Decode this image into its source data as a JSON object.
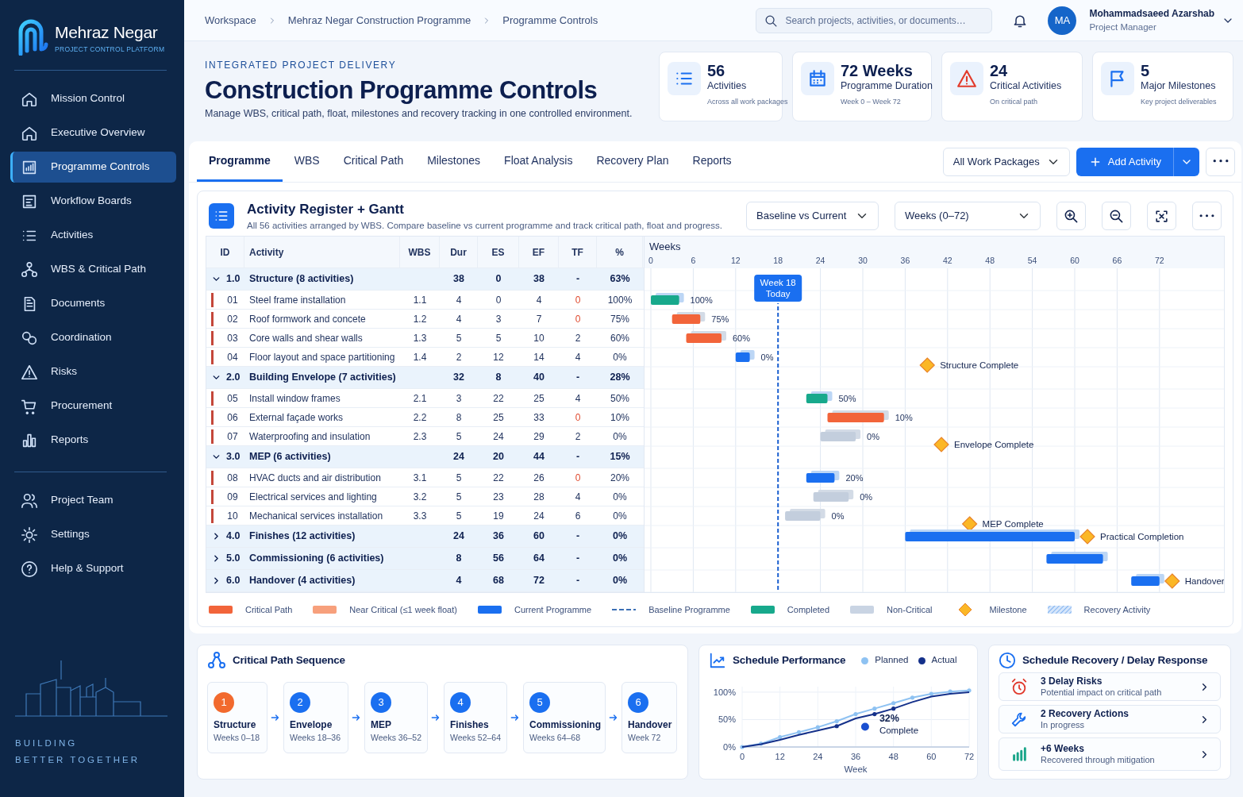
{
  "brand": {
    "name": "Mehraz Negar",
    "tagline": "PROJECT CONTROL PLATFORM"
  },
  "sidebar": {
    "items": [
      {
        "label": "Mission Control",
        "selected": false
      },
      {
        "label": "Executive Overview",
        "selected": false
      },
      {
        "label": "Programme Controls",
        "selected": true
      },
      {
        "label": "Workflow Boards",
        "selected": false
      },
      {
        "label": "Activities",
        "selected": false
      },
      {
        "label": "WBS & Critical Path",
        "selected": false
      },
      {
        "label": "Documents",
        "selected": false
      },
      {
        "label": "Coordination",
        "selected": false
      },
      {
        "label": "Risks",
        "selected": false
      },
      {
        "label": "Procurement",
        "selected": false
      },
      {
        "label": "Reports",
        "selected": false
      }
    ],
    "secondary": [
      {
        "label": "Project Team",
        "selected": false
      },
      {
        "label": "Settings",
        "selected": false
      },
      {
        "label": "Help & Support",
        "selected": false
      }
    ],
    "footer": [
      "BUILDING",
      "BETTER TOGETHER"
    ]
  },
  "breadcrumbs": [
    "Workspace",
    "Mehraz Negar Construction Programme",
    "Programme Controls"
  ],
  "search": {
    "placeholder": "Search projects, activities, or documents…"
  },
  "user": {
    "initials": "MA",
    "name": "Mohammadsaeed Azarshab",
    "role": "Project Manager"
  },
  "header": {
    "eyebrow": "INTEGRATED PROJECT DELIVERY",
    "title": "Construction Programme Controls",
    "subtitle": "Manage WBS, critical path, float, milestones and recovery tracking in one controlled environment."
  },
  "kpis": [
    {
      "value": "56",
      "label": "Activities",
      "note": "Across all work packages",
      "kind": "list"
    },
    {
      "value": "72 Weeks",
      "label": "Programme Duration",
      "note": "Week 0 – Week 72",
      "kind": "calendar"
    },
    {
      "value": "24",
      "label": "Critical Activities",
      "note": "On critical path",
      "kind": "alert"
    },
    {
      "value": "5",
      "label": "Major Milestones",
      "note": "Key project deliverables",
      "kind": "flag"
    }
  ],
  "tabs": [
    {
      "label": "Programme",
      "selected": true
    },
    {
      "label": "WBS",
      "selected": false
    },
    {
      "label": "Critical Path",
      "selected": false
    },
    {
      "label": "Milestones",
      "selected": false
    },
    {
      "label": "Float Analysis",
      "selected": false
    },
    {
      "label": "Recovery Plan",
      "selected": false
    },
    {
      "label": "Reports",
      "selected": false
    }
  ],
  "work_package_filter": "All Work Packages",
  "add_button": "Add Activity",
  "register": {
    "title": "Activity Register + Gantt",
    "description": "All 56 activities arranged by WBS. Compare baseline vs current programme and track critical path, float and progress.",
    "view_select": "Baseline vs Current",
    "range_select": "Weeks (0–72)",
    "columns": [
      "ID",
      "Activity",
      "WBS",
      "Dur",
      "ES",
      "EF",
      "TF",
      "%"
    ],
    "groups": [
      {
        "id": "1.0",
        "name": "Structure (8 activities)",
        "dur": "38",
        "es": "0",
        "ef": "38",
        "tf": "-",
        "pct": "63%",
        "expanded": true,
        "milestone": "Structure Complete",
        "children": [
          {
            "id": "01",
            "name": "Steel frame installation",
            "wbs": "1.1",
            "dur": "4",
            "es": "0",
            "ef": "4",
            "tf": "0",
            "pct": "100%",
            "critical": true,
            "kind": "completed",
            "bar_label": "100%"
          },
          {
            "id": "02",
            "name": "Roof formwork and concete",
            "wbs": "1.2",
            "dur": "4",
            "es": "3",
            "ef": "7",
            "tf": "0",
            "pct": "75%",
            "critical": true,
            "kind": "critical",
            "bar_label": "75%"
          },
          {
            "id": "03",
            "name": "Core walls and shear walls",
            "wbs": "1.3",
            "dur": "5",
            "es": "5",
            "ef": "10",
            "tf": "2",
            "pct": "60%",
            "critical": false,
            "kind": "critical",
            "bar_label": "60%"
          },
          {
            "id": "04",
            "name": "Floor layout and space partitioning",
            "wbs": "1.4",
            "dur": "2",
            "es": "12",
            "ef": "14",
            "tf": "4",
            "pct": "0%",
            "critical": false,
            "kind": "current",
            "bar_label": "0%"
          }
        ]
      },
      {
        "id": "2.0",
        "name": "Building Envelope (7 activities)",
        "dur": "32",
        "es": "8",
        "ef": "40",
        "tf": "-",
        "pct": "28%",
        "expanded": true,
        "milestone": "Envelope Complete",
        "children": [
          {
            "id": "05",
            "name": "Install window frames",
            "wbs": "2.1",
            "dur": "3",
            "es": "22",
            "ef": "25",
            "tf": "4",
            "pct": "50%",
            "critical": false,
            "kind": "completed",
            "bar_label": "50%"
          },
          {
            "id": "06",
            "name": "External façade works",
            "wbs": "2.2",
            "dur": "8",
            "es": "25",
            "ef": "33",
            "tf": "0",
            "pct": "10%",
            "critical": true,
            "kind": "critical",
            "bar_label": "10%"
          },
          {
            "id": "07",
            "name": "Waterproofing and insulation",
            "wbs": "2.3",
            "dur": "5",
            "es": "24",
            "ef": "29",
            "tf": "2",
            "pct": "0%",
            "critical": false,
            "kind": "non_critical",
            "bar_label": "0%"
          }
        ]
      },
      {
        "id": "3.0",
        "name": "MEP (6 activities)",
        "dur": "24",
        "es": "20",
        "ef": "44",
        "tf": "-",
        "pct": "15%",
        "expanded": true,
        "milestone": "MEP Complete",
        "children": [
          {
            "id": "08",
            "name": "HVAC ducts and air distribution",
            "wbs": "3.1",
            "dur": "5",
            "es": "22",
            "ef": "26",
            "tf": "0",
            "pct": "20%",
            "critical": true,
            "kind": "current",
            "bar_label": "20%"
          },
          {
            "id": "09",
            "name": "Electrical services and lighting",
            "wbs": "3.2",
            "dur": "5",
            "es": "23",
            "ef": "28",
            "tf": "4",
            "pct": "0%",
            "critical": false,
            "kind": "non_critical",
            "bar_label": "0%"
          },
          {
            "id": "10",
            "name": "Mechanical services installation",
            "wbs": "3.3",
            "dur": "5",
            "es": "19",
            "ef": "24",
            "tf": "6",
            "pct": "0%",
            "critical": false,
            "kind": "non_critical",
            "bar_label": "0%"
          }
        ]
      },
      {
        "id": "4.0",
        "name": "Finishes (12 activities)",
        "dur": "24",
        "es": "36",
        "ef": "60",
        "tf": "-",
        "pct": "0%",
        "expanded": false,
        "milestone": "Practical Completion",
        "kind": "current"
      },
      {
        "id": "5.0",
        "name": "Commissioning (6 activities)",
        "dur": "8",
        "es": "56",
        "ef": "64",
        "tf": "-",
        "pct": "0%",
        "expanded": false,
        "kind": "current"
      },
      {
        "id": "6.0",
        "name": "Handover (4 activities)",
        "dur": "4",
        "es": "68",
        "ef": "72",
        "tf": "-",
        "pct": "0%",
        "expanded": false,
        "milestone": "Handover",
        "kind": "current"
      }
    ],
    "gantt": {
      "axis_label": "Weeks",
      "today": {
        "label": "Week 18",
        "sub": "Today"
      },
      "ticks": [
        {
          "label": "0",
          "today": false
        },
        {
          "label": "6",
          "today": false
        },
        {
          "label": "12",
          "today": false
        },
        {
          "label": "18",
          "today": true
        },
        {
          "label": "24",
          "today": false
        },
        {
          "label": "30",
          "today": false
        },
        {
          "label": "36",
          "today": false
        },
        {
          "label": "42",
          "today": false
        },
        {
          "label": "48",
          "today": false
        },
        {
          "label": "54",
          "today": false
        },
        {
          "label": "60",
          "today": false
        },
        {
          "label": "66",
          "today": false
        },
        {
          "label": "72",
          "today": false
        }
      ]
    },
    "legend": [
      {
        "label": "Critical Path",
        "kind": "critical"
      },
      {
        "label": "Near Critical (≤1 week float)",
        "kind": "near_critical"
      },
      {
        "label": "Current Programme",
        "kind": "current"
      },
      {
        "label": "Baseline Programme",
        "kind": "baseline"
      },
      {
        "label": "Completed",
        "kind": "completed"
      },
      {
        "label": "Non-Critical",
        "kind": "non_critical"
      },
      {
        "label": "Milestone",
        "kind": "milestone"
      },
      {
        "label": "Recovery Activity",
        "kind": "recovery"
      }
    ]
  },
  "critical_path": {
    "title": "Critical Path Sequence",
    "steps": [
      {
        "number": "1",
        "name": "Structure",
        "weeks": "Weeks 0–18",
        "color": "#f26a2e"
      },
      {
        "number": "2",
        "name": "Envelope",
        "weeks": "Weeks 18–36",
        "color": "#1a6ff0"
      },
      {
        "number": "3",
        "name": "MEP",
        "weeks": "Weeks 36–52",
        "color": "#1a6ff0"
      },
      {
        "number": "4",
        "name": "Finishes",
        "weeks": "Weeks 52–64",
        "color": "#1a6ff0"
      },
      {
        "number": "5",
        "name": "Commissioning",
        "weeks": "Weeks 64–68",
        "color": "#1a6ff0"
      },
      {
        "number": "6",
        "name": "Handover",
        "weeks": "Week 72",
        "color": "#1a6ff0"
      }
    ]
  },
  "performance": {
    "title": "Schedule Performance",
    "chart_data": {
      "type": "line",
      "xlabel": "Week",
      "grid": true,
      "x": [
        0,
        6,
        12,
        18,
        24,
        30,
        36,
        42,
        48,
        54,
        60,
        66,
        72
      ],
      "xlim": [
        0,
        72
      ],
      "ylim": [
        0,
        110
      ],
      "xticks": [
        {
          "value": 0,
          "label": "0"
        },
        {
          "value": 12,
          "label": "12"
        },
        {
          "value": 24,
          "label": "24"
        },
        {
          "value": 36,
          "label": "36"
        },
        {
          "value": 48,
          "label": "48"
        },
        {
          "value": 60,
          "label": "60"
        },
        {
          "value": 72,
          "label": "72"
        }
      ],
      "yticks": [
        {
          "value": 0,
          "label": "0%"
        },
        {
          "value": 50,
          "label": "50%"
        },
        {
          "value": 100,
          "label": "100%"
        }
      ],
      "series": [
        {
          "name": "Planned",
          "color": "#8ec2f2",
          "values": [
            0,
            6,
            18,
            27,
            36,
            47,
            60,
            70,
            80,
            90,
            97,
            101,
            103
          ]
        },
        {
          "name": "Actual",
          "color": "#14308a",
          "values": [
            0,
            5,
            13,
            22,
            30,
            38,
            52,
            60,
            70,
            82,
            92,
            97,
            100
          ]
        }
      ],
      "annotations": [
        {
          "x": 39,
          "y": 37,
          "text": "32%"
        },
        "Complete"
      ]
    }
  },
  "recovery": {
    "title": "Schedule Recovery / Delay Response",
    "items": [
      {
        "title": "3 Delay Risks",
        "subtitle": "Potential impact on critical path",
        "kind": "risk"
      },
      {
        "title": "2 Recovery Actions",
        "subtitle": "In progress",
        "kind": "action"
      },
      {
        "title": "+6 Weeks",
        "subtitle": "Recovered through mitigation",
        "kind": "gain"
      }
    ]
  }
}
